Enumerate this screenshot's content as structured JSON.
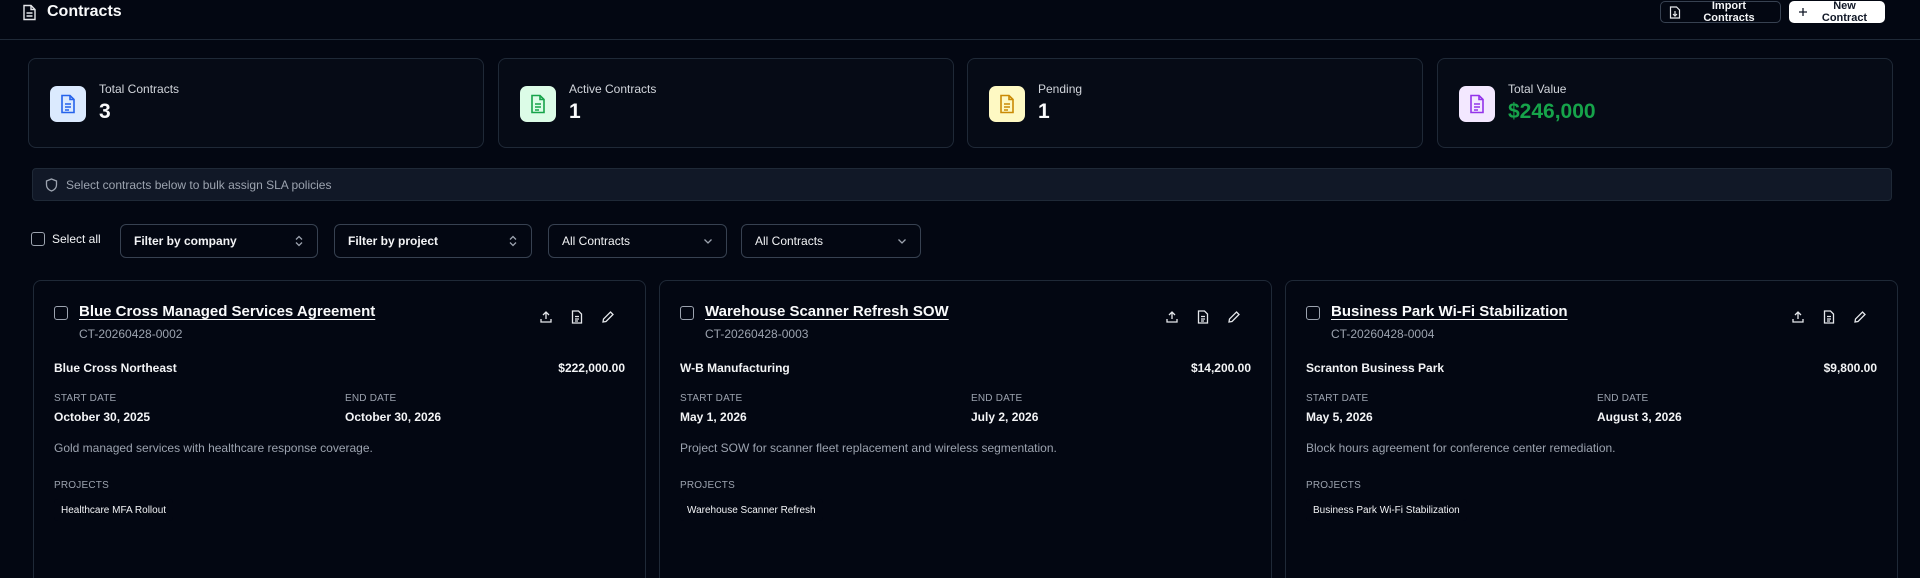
{
  "header": {
    "title": "Contracts",
    "import_label": "Import Contracts",
    "new_label": "New Contract"
  },
  "stats": [
    {
      "label": "Total Contracts",
      "value": "3",
      "icon": "file-text-icon",
      "color": "#3b82f6"
    },
    {
      "label": "Active Contracts",
      "value": "1",
      "icon": "file-check-icon",
      "color": "#22c55e"
    },
    {
      "label": "Pending",
      "value": "1",
      "icon": "file-clock-icon",
      "color": "#eab308"
    },
    {
      "label": "Total Value",
      "value": "$246,000",
      "icon": "file-dollar-icon",
      "color": "#a855f7"
    }
  ],
  "banner": {
    "text": "Select contracts below to bulk assign SLA policies"
  },
  "filters": {
    "select_all": "Select all",
    "company": "Filter by company",
    "project": "Filter by project",
    "status": "All Contracts",
    "type": "All Contracts"
  },
  "labels": {
    "start_date": "START DATE",
    "end_date": "END DATE",
    "projects": "PROJECTS"
  },
  "contracts": [
    {
      "title": "Blue Cross Managed Services Agreement",
      "id": "CT-20260428-0002",
      "company": "Blue Cross Northeast",
      "amount": "$222,000.00",
      "start": "October 30, 2025",
      "end": "October 30, 2026",
      "description": "Gold managed services with healthcare response coverage.",
      "project": "Healthcare MFA Rollout"
    },
    {
      "title": "Warehouse Scanner Refresh SOW",
      "id": "CT-20260428-0003",
      "company": "W-B Manufacturing",
      "amount": "$14,200.00",
      "start": "May 1, 2026",
      "end": "July 2, 2026",
      "description": "Project SOW for scanner fleet replacement and wireless segmentation.",
      "project": "Warehouse Scanner Refresh"
    },
    {
      "title": "Business Park Wi-Fi Stabilization",
      "id": "CT-20260428-0004",
      "company": "Scranton Business Park",
      "amount": "$9,800.00",
      "start": "May 5, 2026",
      "end": "August 3, 2026",
      "description": "Block hours agreement for conference center remediation.",
      "project": "Business Park Wi-Fi Stabilization"
    }
  ]
}
